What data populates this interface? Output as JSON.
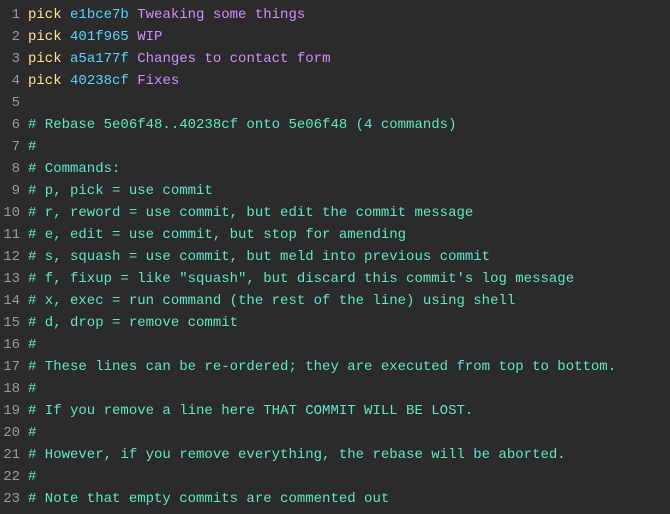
{
  "colors": {
    "background": "#2b2b2b",
    "gutter": "#9a9a9a",
    "cmd": "#ffe48c",
    "hash": "#56d4ff",
    "msg": "#d28cff",
    "comment": "#5fe6c9"
  },
  "lines": [
    {
      "n": "1",
      "type": "pick",
      "cmd": "pick",
      "hash": "e1bce7b",
      "msg": "Tweaking some things"
    },
    {
      "n": "2",
      "type": "pick",
      "cmd": "pick",
      "hash": "401f965",
      "msg": "WIP"
    },
    {
      "n": "3",
      "type": "pick",
      "cmd": "pick",
      "hash": "a5a177f",
      "msg": "Changes to contact form"
    },
    {
      "n": "4",
      "type": "pick",
      "cmd": "pick",
      "hash": "40238cf",
      "msg": "Fixes"
    },
    {
      "n": "5",
      "type": "blank",
      "text": ""
    },
    {
      "n": "6",
      "type": "comment",
      "text": "# Rebase 5e06f48..40238cf onto 5e06f48 (4 commands)"
    },
    {
      "n": "7",
      "type": "comment",
      "text": "#"
    },
    {
      "n": "8",
      "type": "comment",
      "text": "# Commands:"
    },
    {
      "n": "9",
      "type": "comment",
      "text": "# p, pick = use commit"
    },
    {
      "n": "10",
      "type": "comment",
      "text": "# r, reword = use commit, but edit the commit message"
    },
    {
      "n": "11",
      "type": "comment",
      "text": "# e, edit = use commit, but stop for amending"
    },
    {
      "n": "12",
      "type": "comment",
      "text": "# s, squash = use commit, but meld into previous commit"
    },
    {
      "n": "13",
      "type": "comment",
      "text": "# f, fixup = like \"squash\", but discard this commit's log message"
    },
    {
      "n": "14",
      "type": "comment",
      "text": "# x, exec = run command (the rest of the line) using shell"
    },
    {
      "n": "15",
      "type": "comment",
      "text": "# d, drop = remove commit"
    },
    {
      "n": "16",
      "type": "comment",
      "text": "#"
    },
    {
      "n": "17",
      "type": "comment",
      "text": "# These lines can be re-ordered; they are executed from top to bottom."
    },
    {
      "n": "18",
      "type": "comment",
      "text": "#"
    },
    {
      "n": "19",
      "type": "comment",
      "text": "# If you remove a line here THAT COMMIT WILL BE LOST."
    },
    {
      "n": "20",
      "type": "comment",
      "text": "#"
    },
    {
      "n": "21",
      "type": "comment",
      "text": "# However, if you remove everything, the rebase will be aborted."
    },
    {
      "n": "22",
      "type": "comment",
      "text": "#"
    },
    {
      "n": "23",
      "type": "comment",
      "text": "# Note that empty commits are commented out"
    }
  ]
}
